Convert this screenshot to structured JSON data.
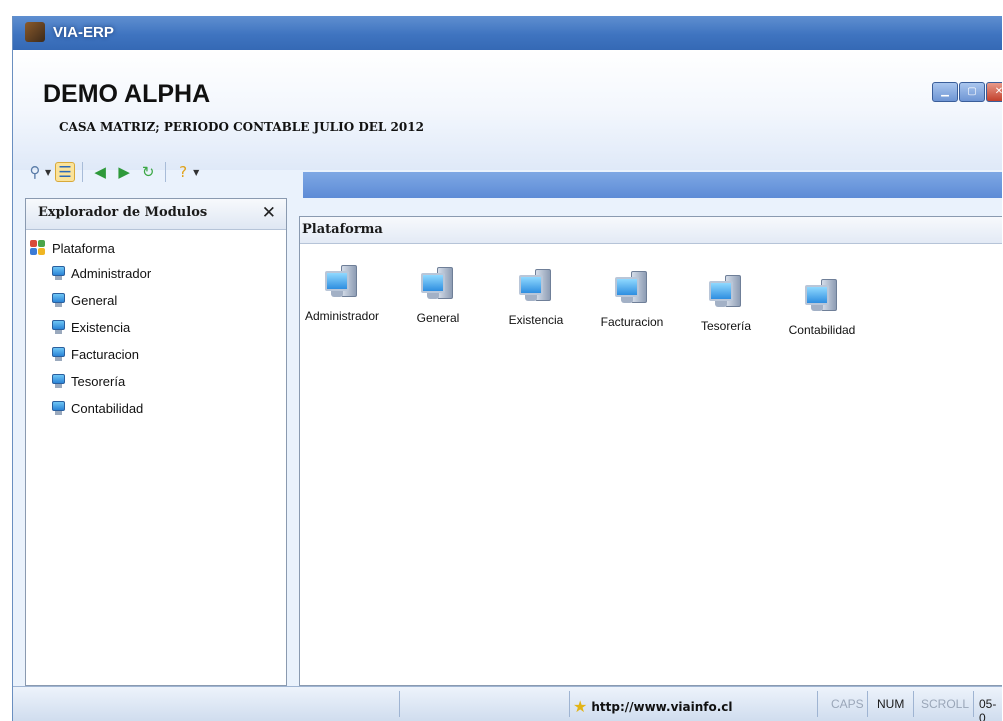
{
  "window": {
    "title": "VIA-ERP"
  },
  "header": {
    "company": "DEMO ALPHA",
    "period": "CASA MATRIZ; PERIODO CONTABLE JULIO DEL 2012"
  },
  "toolbar": {
    "icons": [
      "connect-icon",
      "tree-view-icon",
      "back-icon",
      "forward-icon",
      "refresh-icon",
      "help-icon"
    ]
  },
  "explorer": {
    "title": "Explorador de Modulos",
    "close_symbol": "✕",
    "root": "Plataforma",
    "items": [
      {
        "label": "Administrador"
      },
      {
        "label": "General"
      },
      {
        "label": "Existencia"
      },
      {
        "label": "Facturacion"
      },
      {
        "label": "Tesorería"
      },
      {
        "label": "Contabilidad"
      }
    ]
  },
  "main": {
    "title": "Plataforma",
    "modules": [
      {
        "label": "Administrador"
      },
      {
        "label": "General"
      },
      {
        "label": "Existencia"
      },
      {
        "label": "Facturacion"
      },
      {
        "label": "Tesorería"
      },
      {
        "label": "Contabilidad"
      }
    ]
  },
  "statusbar": {
    "url": "http://www.viainfo.cl",
    "caps": "CAPS",
    "num": "NUM",
    "scroll": "SCROLL",
    "date": "05-0"
  },
  "colors": {
    "titlebar": "#3f74c0",
    "accent_band": "#5d8bd6",
    "selected_tool": "#fbe39a"
  }
}
